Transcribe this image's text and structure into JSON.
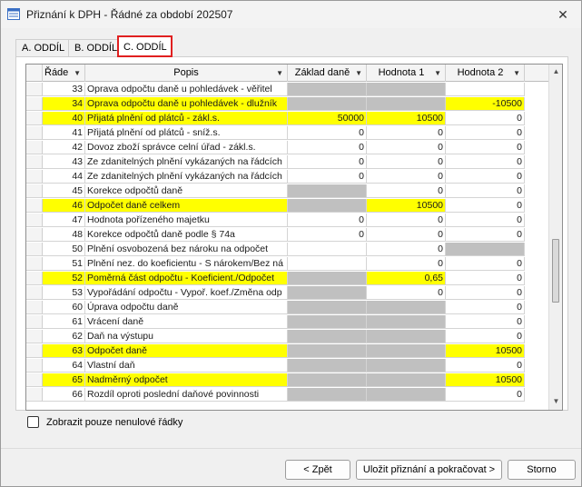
{
  "window": {
    "title": "Přiznání k DPH - Řádné za období 202507",
    "close_glyph": "✕",
    "icon": "form-grid-icon"
  },
  "tabs": [
    {
      "label": "A. ODDÍL",
      "active": false
    },
    {
      "label": "B. ODDÍL",
      "active": false
    },
    {
      "label": "C. ODDÍL",
      "active": true
    }
  ],
  "grid": {
    "columns": [
      "Řáde",
      "Popis",
      "Základ daně",
      "Hodnota 1",
      "Hodnota 2"
    ],
    "rows": [
      {
        "n": "33",
        "desc": "Oprava odpočtu daně u pohledávek - věřitel",
        "zd": "",
        "h1": "",
        "h2": "",
        "hl": [
          "",
          "",
          "g",
          "g",
          ""
        ]
      },
      {
        "n": "34",
        "desc": "Oprava odpočtu daně u pohledávek - dlužník",
        "zd": "",
        "h1": "",
        "h2": "-10500",
        "hl": [
          "y",
          "y",
          "g",
          "g",
          "y"
        ]
      },
      {
        "n": "40",
        "desc": "Přijatá plnění od plátců - zákl.s.",
        "zd": "50000",
        "h1": "10500",
        "h2": "0",
        "hl": [
          "y",
          "y",
          "y",
          "y",
          ""
        ]
      },
      {
        "n": "41",
        "desc": "Přijatá plnění od plátců - sníž.s.",
        "zd": "0",
        "h1": "0",
        "h2": "0",
        "hl": [
          "",
          "",
          "",
          "",
          ""
        ]
      },
      {
        "n": "42",
        "desc": "Dovoz zboží správce celní úřad - zákl.s.",
        "zd": "0",
        "h1": "0",
        "h2": "0",
        "hl": [
          "",
          "",
          "",
          "",
          ""
        ]
      },
      {
        "n": "43",
        "desc": "Ze zdanitelných plnění vykázaných na řádcích",
        "zd": "0",
        "h1": "0",
        "h2": "0",
        "hl": [
          "",
          "",
          "",
          "",
          ""
        ]
      },
      {
        "n": "44",
        "desc": "Ze zdanitelných plnění vykázaných na řádcích",
        "zd": "0",
        "h1": "0",
        "h2": "0",
        "hl": [
          "",
          "",
          "",
          "",
          ""
        ]
      },
      {
        "n": "45",
        "desc": "Korekce odpočtů daně",
        "zd": "",
        "h1": "0",
        "h2": "0",
        "hl": [
          "",
          "",
          "g",
          "",
          ""
        ]
      },
      {
        "n": "46",
        "desc": "Odpočet daně celkem",
        "zd": "",
        "h1": "10500",
        "h2": "0",
        "hl": [
          "y",
          "y",
          "g",
          "y",
          ""
        ]
      },
      {
        "n": "47",
        "desc": "Hodnota pořízeného majetku",
        "zd": "0",
        "h1": "0",
        "h2": "0",
        "hl": [
          "",
          "",
          "",
          "",
          ""
        ]
      },
      {
        "n": "48",
        "desc": "Korekce odpočtů daně podle § 74a",
        "zd": "0",
        "h1": "0",
        "h2": "0",
        "hl": [
          "",
          "",
          "",
          "",
          ""
        ]
      },
      {
        "n": "50",
        "desc": "Plnění osvobozená bez nároku na odpočet",
        "zd": "",
        "h1": "0",
        "h2": "",
        "hl": [
          "",
          "",
          "",
          "",
          "g"
        ]
      },
      {
        "n": "51",
        "desc": "Plnění nez. do koeficientu - S nárokem/Bez ná",
        "zd": "",
        "h1": "0",
        "h2": "0",
        "hl": [
          "",
          "",
          "",
          "",
          ""
        ]
      },
      {
        "n": "52",
        "desc": "Poměrná část odpočtu - Koeficient./Odpočet",
        "zd": "",
        "h1": "0,65",
        "h2": "0",
        "hl": [
          "y",
          "y",
          "g",
          "y",
          ""
        ]
      },
      {
        "n": "53",
        "desc": "Vypořádání odpočtu - Vypoř. koef./Změna odp",
        "zd": "",
        "h1": "0",
        "h2": "0",
        "hl": [
          "",
          "",
          "g",
          "",
          ""
        ]
      },
      {
        "n": "60",
        "desc": "Úprava odpočtu daně",
        "zd": "",
        "h1": "",
        "h2": "0",
        "hl": [
          "",
          "",
          "g",
          "g",
          ""
        ]
      },
      {
        "n": "61",
        "desc": "Vrácení daně",
        "zd": "",
        "h1": "",
        "h2": "0",
        "hl": [
          "",
          "",
          "g",
          "g",
          ""
        ]
      },
      {
        "n": "62",
        "desc": "Daň na výstupu",
        "zd": "",
        "h1": "",
        "h2": "0",
        "hl": [
          "",
          "",
          "g",
          "g",
          ""
        ]
      },
      {
        "n": "63",
        "desc": "Odpočet daně",
        "zd": "",
        "h1": "",
        "h2": "10500",
        "hl": [
          "y",
          "y",
          "g",
          "g",
          "y"
        ]
      },
      {
        "n": "64",
        "desc": "Vlastní daň",
        "zd": "",
        "h1": "",
        "h2": "0",
        "hl": [
          "",
          "",
          "g",
          "g",
          ""
        ]
      },
      {
        "n": "65",
        "desc": "Nadměrný odpočet",
        "zd": "",
        "h1": "",
        "h2": "10500",
        "hl": [
          "y",
          "y",
          "g",
          "g",
          "y"
        ]
      },
      {
        "n": "66",
        "desc": "Rozdíl oproti poslední daňové povinnosti",
        "zd": "",
        "h1": "",
        "h2": "0",
        "hl": [
          "",
          "",
          "g",
          "g",
          ""
        ]
      }
    ]
  },
  "filter": {
    "label": "Zobrazit pouze nenulové řádky",
    "checked": false
  },
  "buttons": {
    "back": "< Zpět",
    "save_continue": "Uložit přiznání a pokračovat >",
    "cancel": "Storno"
  },
  "colors": {
    "highlight": "#ffff00",
    "disabled": "#c0c0c0",
    "active_tab_border": "#e02020"
  }
}
